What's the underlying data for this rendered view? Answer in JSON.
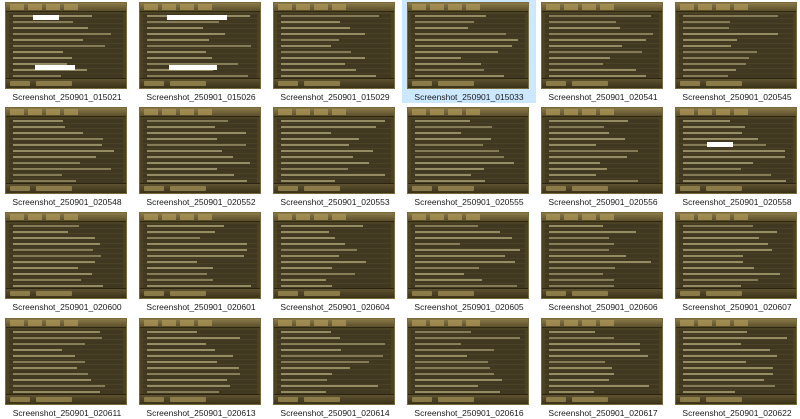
{
  "files": [
    {
      "name": "Screenshot_250901_015021"
    },
    {
      "name": "Screenshot_250901_015026"
    },
    {
      "name": "Screenshot_250901_015029"
    },
    {
      "name": "Screenshot_250901_015033",
      "selected": true
    },
    {
      "name": "Screenshot_250901_020541"
    },
    {
      "name": "Screenshot_250901_020545"
    },
    {
      "name": "Screenshot_250901_020548"
    },
    {
      "name": "Screenshot_250901_020552"
    },
    {
      "name": "Screenshot_250901_020553"
    },
    {
      "name": "Screenshot_250901_020555"
    },
    {
      "name": "Screenshot_250901_020556"
    },
    {
      "name": "Screenshot_250901_020558"
    },
    {
      "name": "Screenshot_250901_020600"
    },
    {
      "name": "Screenshot_250901_020601"
    },
    {
      "name": "Screenshot_250901_020604"
    },
    {
      "name": "Screenshot_250901_020605"
    },
    {
      "name": "Screenshot_250901_020606"
    },
    {
      "name": "Screenshot_250901_020607"
    },
    {
      "name": "Screenshot_250901_020611"
    },
    {
      "name": "Screenshot_250901_020613"
    },
    {
      "name": "Screenshot_250901_020614"
    },
    {
      "name": "Screenshot_250901_020616"
    },
    {
      "name": "Screenshot_250901_020617"
    },
    {
      "name": "Screenshot_250901_020622"
    }
  ],
  "colors": {
    "selection": "#cce8ff",
    "chat_background": "#403820",
    "chat_text": "#d9cf9a",
    "redaction": "#ffffff"
  }
}
